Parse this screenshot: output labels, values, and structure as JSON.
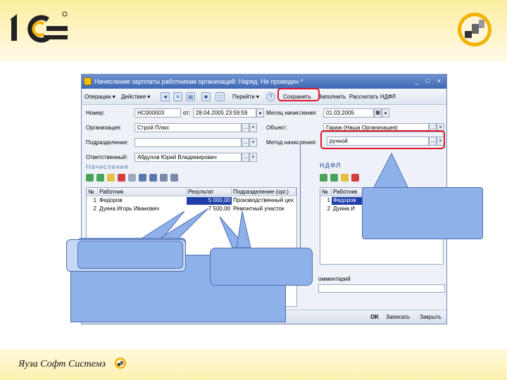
{
  "slide": {
    "footer_company": "Яуза Софт Системз",
    "brand_colors": {
      "header": "#fbeea0",
      "logo": "#f2b200",
      "callout": "#8fb1ea",
      "highlight": "#e0142a"
    }
  },
  "window": {
    "title": "Начисление зарплаты работникам организаций: Наряд. Не проведен *",
    "controls": "_ □ ×",
    "toolbar": {
      "operations": "Операции ▾",
      "actions": "Действия ▾",
      "goto": "Перейти ▾",
      "help": "?",
      "save": "Сохранить",
      "fill": "Заполнить",
      "calc_ndfl": "Рассчитать НДФЛ"
    },
    "fields": {
      "number_label": "Номер:",
      "number_value": "НС000003",
      "from_label": "от:",
      "date_value": "28.04.2005 23:59:59",
      "month_label": "Месяц начисления:",
      "month_value": "01.03.2005",
      "org_label": "Организация:",
      "org_value": "Строй Плюс",
      "object_label": "Объект:",
      "object_value": "Гараж (Наша Организация)",
      "division_label": "Подразделение:",
      "division_value": "",
      "method_label": "Метод начисления:",
      "method_value": "ручной",
      "responsible_label": "Ответственный:",
      "responsible_value": "Абдулов Юрий Владимирович"
    },
    "accruals": {
      "title": "Начисления",
      "columns": [
        "№",
        "Работник",
        "Результат",
        "Подразделение (орг.)"
      ],
      "rows": [
        [
          "1",
          "Федоров",
          "5 000,00",
          "Производственный цех"
        ],
        [
          "2",
          "Дуина Игорь Иванович",
          "7 500,00",
          "Ремонтный участок"
        ]
      ]
    },
    "ndfl": {
      "title": "НДФЛ",
      "columns": [
        "№",
        "Работник"
      ],
      "rows": [
        [
          "1",
          "Федоров"
        ],
        [
          "2",
          "Дуина И"
        ]
      ]
    },
    "comment_label": "омментарий",
    "buttons": {
      "ok": "OK",
      "write": "Записать",
      "close": "Закрыть"
    }
  }
}
